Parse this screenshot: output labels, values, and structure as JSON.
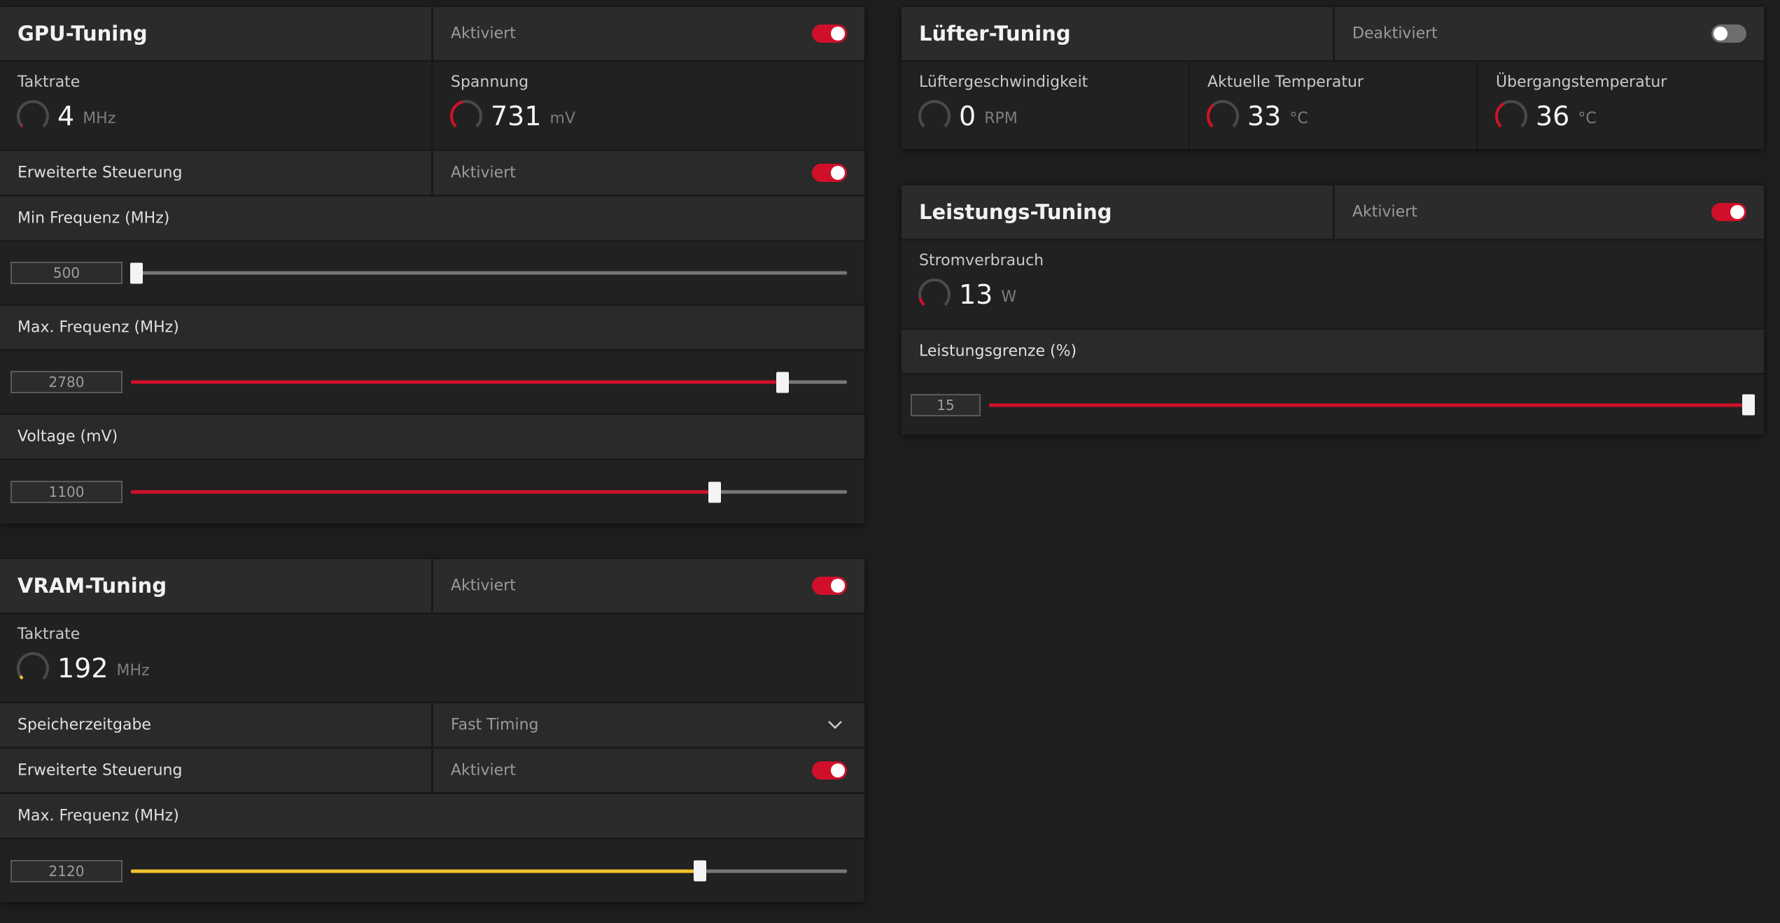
{
  "gpu": {
    "title": "GPU-Tuning",
    "status": "Aktiviert",
    "enabled": true,
    "clock": {
      "label": "Taktrate",
      "value": "4",
      "unit": "MHz",
      "fraction": 0.01
    },
    "voltage": {
      "label": "Spannung",
      "value": "731",
      "unit": "mV",
      "fraction": 0.45
    },
    "advanced": {
      "label": "Erweiterte Steuerung",
      "status": "Aktiviert",
      "enabled": true
    },
    "min_freq": {
      "label": "Min Frequenz (MHz)",
      "value": "500",
      "fill_fraction": 0.0,
      "thumb_fraction": 0.0
    },
    "max_freq": {
      "label": "Max. Frequenz (MHz)",
      "value": "2780",
      "fill_fraction": 0.91,
      "thumb_fraction": 0.91
    },
    "voltage_slider": {
      "label": "Voltage (mV)",
      "value": "1100",
      "fill_fraction": 0.815,
      "thumb_fraction": 0.815
    }
  },
  "fan": {
    "title": "Lüfter-Tuning",
    "status": "Deaktiviert",
    "enabled": false,
    "speed": {
      "label": "Lüftergeschwindigkeit",
      "value": "0",
      "unit": "RPM",
      "fraction": 0.0
    },
    "temp": {
      "label": "Aktuelle Temperatur",
      "value": "33",
      "unit": "°C",
      "fraction": 0.35
    },
    "junction": {
      "label": "Übergangstemperatur",
      "value": "36",
      "unit": "°C",
      "fraction": 0.38
    }
  },
  "power": {
    "title": "Leistungs-Tuning",
    "status": "Aktiviert",
    "enabled": true,
    "consumption": {
      "label": "Stromverbrauch",
      "value": "13",
      "unit": "W",
      "fraction": 0.12
    },
    "limit": {
      "label": "Leistungsgrenze (%)",
      "value": "15",
      "fill_fraction": 1.0,
      "thumb_fraction": 1.0
    }
  },
  "vram": {
    "title": "VRAM-Tuning",
    "status": "Aktiviert",
    "enabled": true,
    "clock": {
      "label": "Taktrate",
      "value": "192",
      "unit": "MHz",
      "fraction": 0.05
    },
    "timing": {
      "label": "Speicherzeitgabe",
      "value": "Fast Timing"
    },
    "advanced": {
      "label": "Erweiterte Steuerung",
      "status": "Aktiviert",
      "enabled": true
    },
    "max_freq": {
      "label": "Max. Frequenz (MHz)",
      "value": "2120",
      "fill_fraction": 0.795,
      "thumb_fraction": 0.795
    }
  },
  "colors": {
    "accent": "#d0102a",
    "vram_fill": "#f2c230",
    "track": "#777777",
    "gauge_bg": "#4a4a4a"
  }
}
